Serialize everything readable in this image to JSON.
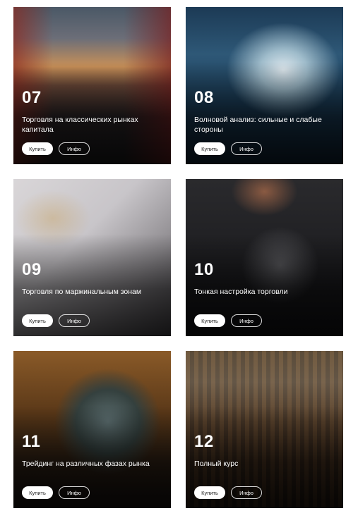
{
  "courses": [
    {
      "number": "07",
      "title": "Торговля на классических рынках капитала",
      "buy_label": "Купить",
      "info_label": "Инфо",
      "image": "city-street-photo"
    },
    {
      "number": "08",
      "title": "Волновой анализ: сильные и слабые стороны",
      "buy_label": "Купить",
      "info_label": "Инфо",
      "image": "ocean-wave-photo"
    },
    {
      "number": "09",
      "title": "Торговля по маржинальным зонам",
      "buy_label": "Купить",
      "info_label": "Инфо",
      "image": "desk-glasses-photo"
    },
    {
      "number": "10",
      "title": "Тонкая настройка торговли",
      "buy_label": "Купить",
      "info_label": "Инфо",
      "image": "suit-tie-photo"
    },
    {
      "number": "11",
      "title": "Трейдинг на различных фазах рынка",
      "buy_label": "Купить",
      "info_label": "Инфо",
      "image": "statue-photo"
    },
    {
      "number": "12",
      "title": "Полный курс",
      "buy_label": "Купить",
      "info_label": "Инфо",
      "image": "library-photo"
    }
  ]
}
